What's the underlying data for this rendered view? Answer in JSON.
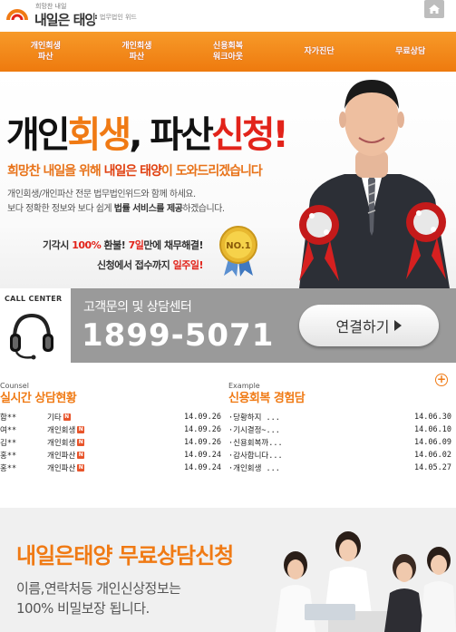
{
  "header": {
    "logo_sub": "희망찬 내일",
    "logo_main": "내일은 태양",
    "logo_firm": "법무법인 위드",
    "home_icon": "home-icon"
  },
  "nav": {
    "items": [
      {
        "label": "개인회생\n파산"
      },
      {
        "label": "개인회생\n파산"
      },
      {
        "label": "신용회복\n워크아웃"
      },
      {
        "label": "자가진단"
      },
      {
        "label": "무료상담"
      }
    ]
  },
  "hero": {
    "title_part1": "개인",
    "title_part2": "회생",
    "title_part3": ", 파산",
    "title_part4": "신청!",
    "sub_part1": "희망찬 내일을 위해 ",
    "sub_part2": "내일은 태양",
    "sub_part3": "이 도와드리겠습니다",
    "desc_line1": "개인회생/개인파산 전문 법무법인위드와 함께 하세요.",
    "desc_line2_a": "보다 정확한 정보와 보다 쉽게 ",
    "desc_line2_b": "법률 서비스를 제공",
    "desc_line2_c": "하겠습니다.",
    "promo_line1_a": "기각시 ",
    "promo_line1_b": "100%",
    "promo_line1_c": " 환불! ",
    "promo_line1_d": "7일",
    "promo_line1_e": "만에 채무해결!",
    "promo_line2_a": "신청에서 접수까지 ",
    "promo_line2_b": "일주일!",
    "badge_text": "NO.1"
  },
  "call": {
    "label": "CALL CENTER",
    "title": "고객문의 및 상담센터",
    "phone": "1899-5071",
    "button_label": "연결하기"
  },
  "counsel": {
    "caption": "Counsel",
    "title": "실시간 상담현황",
    "rows": [
      {
        "name": "함**",
        "type": "기타",
        "date": "14.09.26"
      },
      {
        "name": "여**",
        "type": "개인회생",
        "date": "14.09.26"
      },
      {
        "name": "김**",
        "type": "개인회생",
        "date": "14.09.26"
      },
      {
        "name": "홍**",
        "type": "개인파산",
        "date": "14.09.24"
      },
      {
        "name": "홍**",
        "type": "개인파산",
        "date": "14.09.24"
      }
    ]
  },
  "example": {
    "caption": "Example",
    "title": "신용회복 경험담",
    "plus_label": "+",
    "rows": [
      {
        "title": "·당황하지 ...",
        "date": "14.06.30"
      },
      {
        "title": "·기시결정~...",
        "date": "14.06.10"
      },
      {
        "title": "·신용회복까...",
        "date": "14.06.09"
      },
      {
        "title": "·감사합니다...",
        "date": "14.06.02"
      },
      {
        "title": "·개인회생 ...",
        "date": "14.05.27"
      }
    ]
  },
  "bottom": {
    "title": "내일은태양 무료상담신청",
    "desc_line1": "이름,연락처등 개인신상정보는",
    "desc_line2": "100% 비밀보장 됩니다."
  },
  "colors": {
    "brand_orange": "#f07a14",
    "accent_red": "#e2231a",
    "nav_orange": "#f08a1c",
    "call_gray": "#9a9a9a"
  }
}
